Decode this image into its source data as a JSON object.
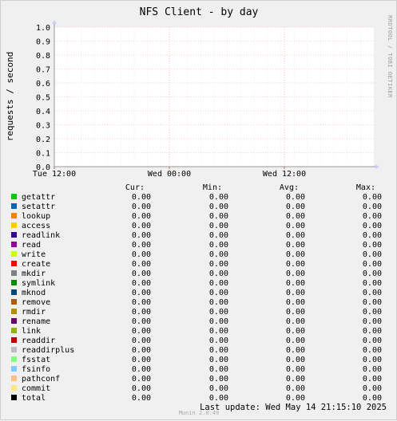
{
  "chart_data": {
    "type": "line",
    "title": "NFS Client - by day",
    "ylabel": "requests / second",
    "ylim": [
      0,
      1.0
    ],
    "yticks": [
      "0.0",
      "0.1",
      "0.2",
      "0.3",
      "0.4",
      "0.5",
      "0.6",
      "0.7",
      "0.8",
      "0.9",
      "1.0"
    ],
    "xticks": [
      "Tue 12:00",
      "Wed 00:00",
      "Wed 12:00"
    ],
    "grid": true,
    "side_text": "RRDTOOL / TOBI OETIKER",
    "columns": [
      "Cur:",
      "Min:",
      "Avg:",
      "Max:"
    ],
    "series": [
      {
        "name": "getattr",
        "color": "#00cc00",
        "values": [
          "0.00",
          "0.00",
          "0.00",
          "0.00"
        ]
      },
      {
        "name": "setattr",
        "color": "#0066b3",
        "values": [
          "0.00",
          "0.00",
          "0.00",
          "0.00"
        ]
      },
      {
        "name": "lookup",
        "color": "#ff8000",
        "values": [
          "0.00",
          "0.00",
          "0.00",
          "0.00"
        ]
      },
      {
        "name": "access",
        "color": "#ffcc00",
        "values": [
          "0.00",
          "0.00",
          "0.00",
          "0.00"
        ]
      },
      {
        "name": "readlink",
        "color": "#330099",
        "values": [
          "0.00",
          "0.00",
          "0.00",
          "0.00"
        ]
      },
      {
        "name": "read",
        "color": "#990099",
        "values": [
          "0.00",
          "0.00",
          "0.00",
          "0.00"
        ]
      },
      {
        "name": "write",
        "color": "#ccff00",
        "values": [
          "0.00",
          "0.00",
          "0.00",
          "0.00"
        ]
      },
      {
        "name": "create",
        "color": "#ff0000",
        "values": [
          "0.00",
          "0.00",
          "0.00",
          "0.00"
        ]
      },
      {
        "name": "mkdir",
        "color": "#808080",
        "values": [
          "0.00",
          "0.00",
          "0.00",
          "0.00"
        ]
      },
      {
        "name": "symlink",
        "color": "#008f00",
        "values": [
          "0.00",
          "0.00",
          "0.00",
          "0.00"
        ]
      },
      {
        "name": "mknod",
        "color": "#00487d",
        "values": [
          "0.00",
          "0.00",
          "0.00",
          "0.00"
        ]
      },
      {
        "name": "remove",
        "color": "#b35a00",
        "values": [
          "0.00",
          "0.00",
          "0.00",
          "0.00"
        ]
      },
      {
        "name": "rmdir",
        "color": "#b38f00",
        "values": [
          "0.00",
          "0.00",
          "0.00",
          "0.00"
        ]
      },
      {
        "name": "rename",
        "color": "#6b006b",
        "values": [
          "0.00",
          "0.00",
          "0.00",
          "0.00"
        ]
      },
      {
        "name": "link",
        "color": "#8fb300",
        "values": [
          "0.00",
          "0.00",
          "0.00",
          "0.00"
        ]
      },
      {
        "name": "readdir",
        "color": "#b30000",
        "values": [
          "0.00",
          "0.00",
          "0.00",
          "0.00"
        ]
      },
      {
        "name": "readdirplus",
        "color": "#bebebe",
        "values": [
          "0.00",
          "0.00",
          "0.00",
          "0.00"
        ]
      },
      {
        "name": "fsstat",
        "color": "#80ff80",
        "values": [
          "0.00",
          "0.00",
          "0.00",
          "0.00"
        ]
      },
      {
        "name": "fsinfo",
        "color": "#80c9ff",
        "values": [
          "0.00",
          "0.00",
          "0.00",
          "0.00"
        ]
      },
      {
        "name": "pathconf",
        "color": "#ffc080",
        "values": [
          "0.00",
          "0.00",
          "0.00",
          "0.00"
        ]
      },
      {
        "name": "commit",
        "color": "#ffe680",
        "values": [
          "0.00",
          "0.00",
          "0.00",
          "0.00"
        ]
      },
      {
        "name": "total",
        "color": "#000000",
        "values": [
          "0.00",
          "0.00",
          "0.00",
          "0.00"
        ]
      }
    ],
    "last_update": "Last update: Wed May 14 21:15:10 2025",
    "version": "Munin 2.0.49"
  }
}
